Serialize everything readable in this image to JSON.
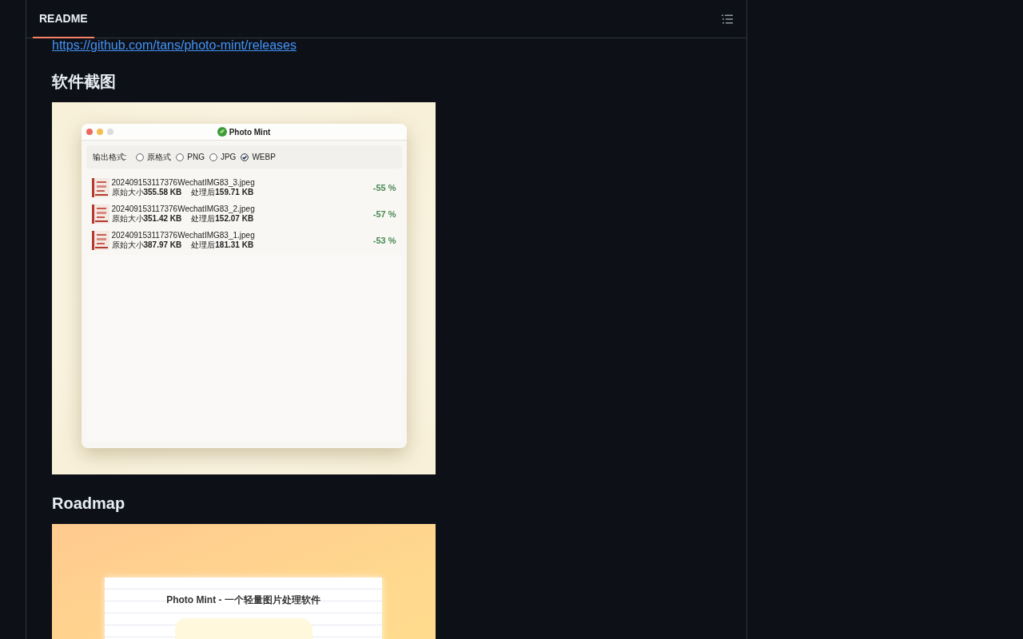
{
  "readme": {
    "tab": {
      "label": "README",
      "selected": true
    },
    "link": "https://github.com/tans/photo-mint/releases",
    "sections": [
      {
        "heading": "软件截图",
        "screenshot": {
          "kind": "app_window",
          "title": "Photo Mint",
          "format_label": "输出格式:",
          "formats": [
            {
              "label": "原格式",
              "selected": false
            },
            {
              "label": "PNG",
              "selected": false
            },
            {
              "label": "JPG",
              "selected": false
            },
            {
              "label": "WEBP",
              "selected": true
            }
          ],
          "files": [
            {
              "name": "202409153117376WechatIMG83_3.jpeg",
              "original": "原始大小**355.58 KB**",
              "processed": "处理后**159.71 KB**",
              "change": "-55 %"
            },
            {
              "name": "202409153117376WechatIMG83_2.jpeg",
              "original": "原始大小**351.42 KB**",
              "processed": "处理后**152.07 KB**",
              "change": "-57 %"
            },
            {
              "name": "202409153117376WechatIMG83_1.jpeg",
              "original": "原始大小**387.97 KB**",
              "processed": "处理后**181.31 KB**",
              "change": "-53 %"
            }
          ]
        }
      },
      {
        "heading": "Roadmap",
        "screenshot": {
          "kind": "roadmap_card",
          "title": "Photo Mint - 一个轻量图片处理软件"
        }
      }
    ]
  }
}
